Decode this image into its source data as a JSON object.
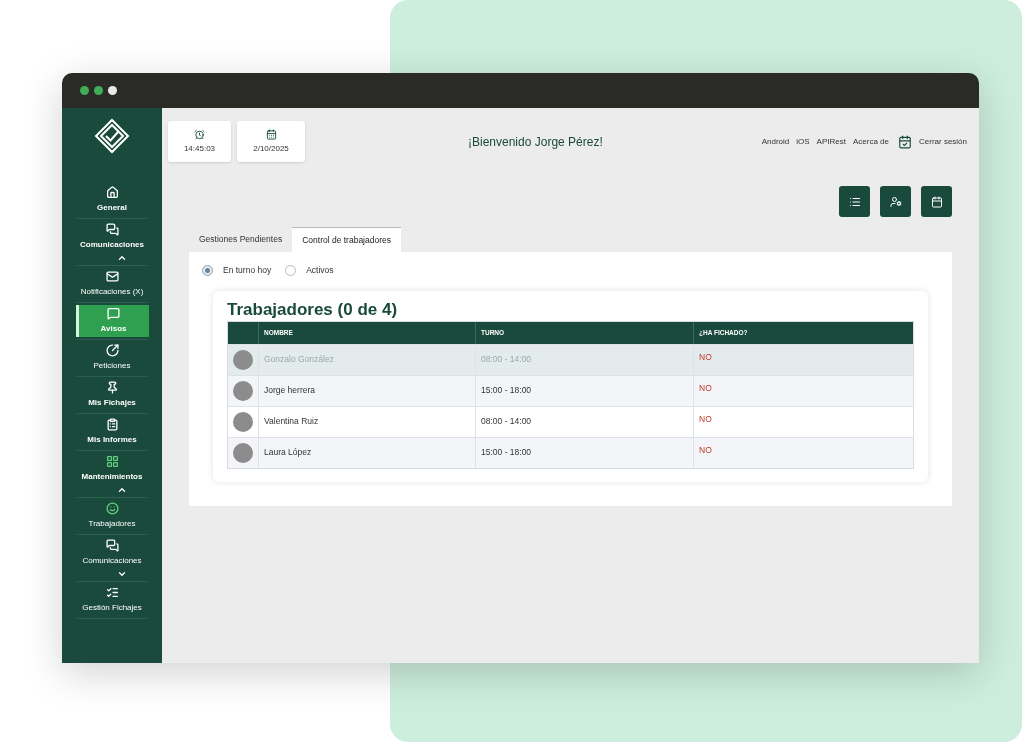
{
  "sidebar": {
    "items": [
      {
        "kind": "header",
        "label": "General",
        "selected": false
      },
      {
        "kind": "header",
        "label": "Comunicaciones",
        "selected": false,
        "expanded": true
      },
      {
        "kind": "subitem",
        "label": "Notificaciones (X)",
        "selected": false
      },
      {
        "kind": "header",
        "label": "Avisos",
        "selected": true
      },
      {
        "kind": "subitem",
        "label": "Peticiones",
        "selected": false
      },
      {
        "kind": "header",
        "label": "Mis Fichajes",
        "selected": false
      },
      {
        "kind": "header",
        "label": "Mis Informes",
        "selected": false
      },
      {
        "kind": "header",
        "label": "Mantenimientos",
        "selected": false,
        "expanded": true
      },
      {
        "kind": "subitem",
        "label": "Trabajadores",
        "selected": false
      },
      {
        "kind": "subitem",
        "label": "Comunicaciones",
        "selected": false,
        "expanded": false
      },
      {
        "kind": "subitem",
        "label": "Gestión Fichajes",
        "selected": false
      }
    ]
  },
  "header": {
    "time": "14:45:03",
    "date": "2/10/2025",
    "welcome": "¡Bienvenido Jorge Pérez!",
    "links": [
      "Android",
      "iOS",
      "APIRest",
      "Acerca de"
    ],
    "logout": "Cerrar sesión"
  },
  "tabs": [
    {
      "label": "Gestiones Pendientes",
      "selected": false
    },
    {
      "label": "Control de trabajadores",
      "selected": true
    }
  ],
  "filters": [
    {
      "label": "En turno hoy",
      "selected": true
    },
    {
      "label": "Activos",
      "selected": false
    }
  ],
  "table": {
    "title": "Trabajadores (0 de 4)",
    "columns": [
      "NOMBRE",
      "TURNO",
      "¿HA FICHADO?"
    ],
    "rows": [
      {
        "name": "Gonzalo González",
        "shift": "08:00 - 14:00",
        "clocked": "NO",
        "selected": true
      },
      {
        "name": "Jorge herrera",
        "shift": "15:00 - 18:00",
        "clocked": "NO",
        "selected": false
      },
      {
        "name": "Valentina Ruiz",
        "shift": "08:00 - 14:00",
        "clocked": "NO",
        "selected": false
      },
      {
        "name": "Laura López",
        "shift": "15:00 - 18:00",
        "clocked": "NO",
        "selected": false
      }
    ]
  }
}
